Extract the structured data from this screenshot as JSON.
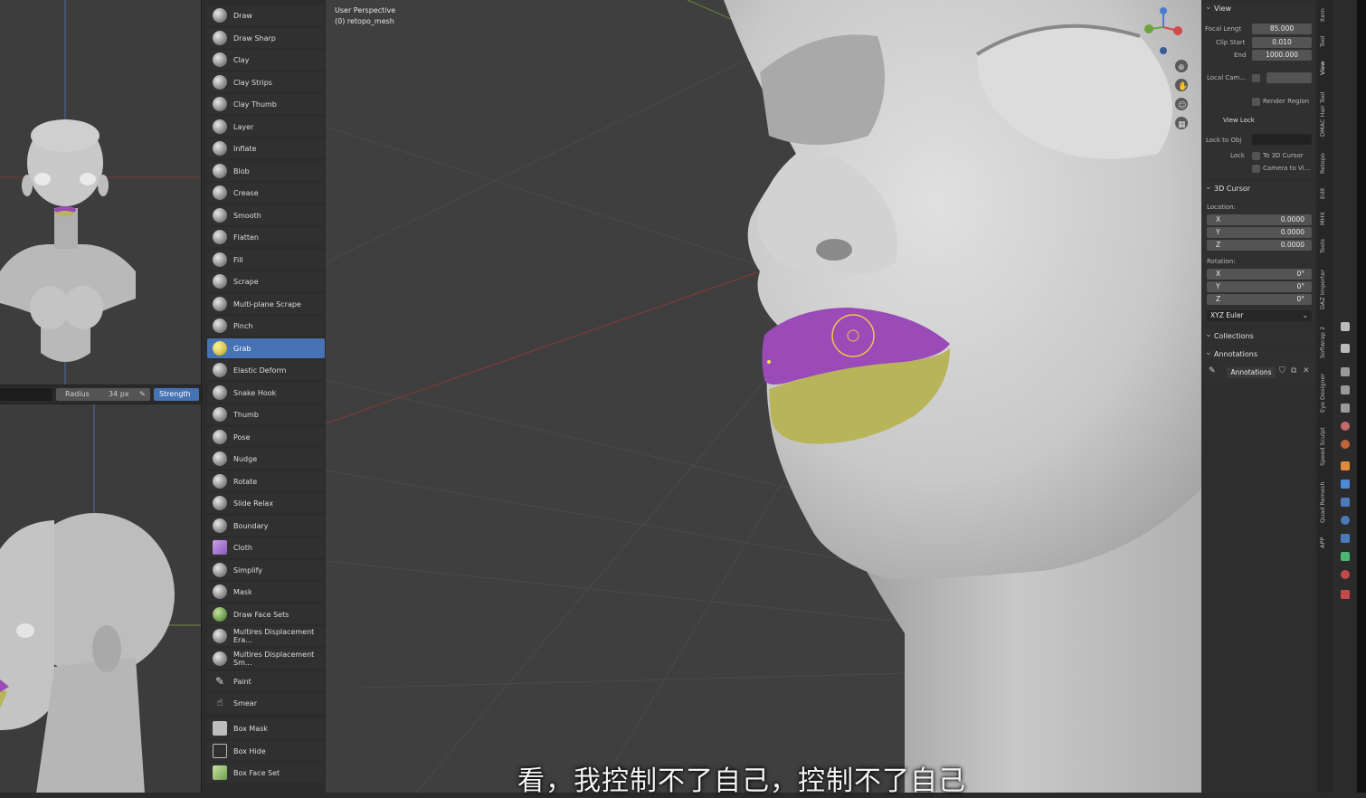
{
  "brush_header": {
    "radius_label": "Radius",
    "radius_value": "34 px",
    "strength_label": "Strength"
  },
  "viewport": {
    "perspective": "User Perspective",
    "object": "(0) retopo_mesh"
  },
  "tools": [
    {
      "label": "Draw"
    },
    {
      "label": "Draw Sharp"
    },
    {
      "label": "Clay"
    },
    {
      "label": "Clay Strips"
    },
    {
      "label": "Clay Thumb"
    },
    {
      "label": "Layer"
    },
    {
      "label": "Inflate"
    },
    {
      "label": "Blob"
    },
    {
      "label": "Crease"
    },
    {
      "label": "Smooth"
    },
    {
      "label": "Flatten"
    },
    {
      "label": "Fill"
    },
    {
      "label": "Scrape"
    },
    {
      "label": "Multi-plane Scrape"
    },
    {
      "label": "Pinch"
    },
    {
      "label": "Grab",
      "active": true
    },
    {
      "label": "Elastic Deform"
    },
    {
      "label": "Snake Hook"
    },
    {
      "label": "Thumb"
    },
    {
      "label": "Pose"
    },
    {
      "label": "Nudge"
    },
    {
      "label": "Rotate"
    },
    {
      "label": "Slide Relax"
    },
    {
      "label": "Boundary"
    },
    {
      "label": "Cloth"
    },
    {
      "label": "Simplify"
    },
    {
      "label": "Mask"
    },
    {
      "label": "Draw Face Sets"
    },
    {
      "label": "Multires Displacement Era..."
    },
    {
      "label": "Multires Displacement Sm..."
    },
    {
      "label": "Paint"
    },
    {
      "label": "Smear"
    },
    {
      "label": "Box Mask"
    },
    {
      "label": "Box Hide"
    },
    {
      "label": "Box Face Set"
    }
  ],
  "npanel": {
    "view": {
      "title": "View",
      "focal_label": "Focal Lengt",
      "focal_value": "85.000",
      "clip_start_label": "Clip Start",
      "clip_start_value": "0.010",
      "end_label": "End",
      "end_value": "1000.000",
      "local_cam_label": "Local Cam...",
      "render_region_label": "Render Region",
      "view_lock_title": "View Lock",
      "lock_to_obj_label": "Lock to Obj",
      "lock_label": "Lock",
      "to_cursor_label": "To 3D Cursor",
      "camera_to_view_label": "Camera to Vi..."
    },
    "cursor": {
      "title": "3D Cursor",
      "location_label": "Location:",
      "loc": [
        {
          "axis": "X",
          "value": "0.0000"
        },
        {
          "axis": "Y",
          "value": "0.0000"
        },
        {
          "axis": "Z",
          "value": "0.0000"
        }
      ],
      "rotation_label": "Rotation:",
      "rot": [
        {
          "axis": "X",
          "value": "0°"
        },
        {
          "axis": "Y",
          "value": "0°"
        },
        {
          "axis": "Z",
          "value": "0°"
        }
      ],
      "mode": "XYZ Euler"
    },
    "collections_title": "Collections",
    "annotations_title": "Annotations",
    "annotations_field": "Annotations"
  },
  "tabs": [
    "Item",
    "Tool",
    "View",
    "DMAC Hair Tool",
    "Retopo",
    "Edit",
    "MHX",
    "Tools",
    "DAZ Importer",
    "Softwrap 2",
    "Eye Designer",
    "Speed Sculpt",
    "Quad Remesh",
    "APP"
  ],
  "subtitle": "看，我控制不了自己，控制不了自己",
  "colors": {
    "accent": "#4772b3",
    "upper_lip": "#9a4bb8",
    "lower_lip": "#b8b45a"
  }
}
